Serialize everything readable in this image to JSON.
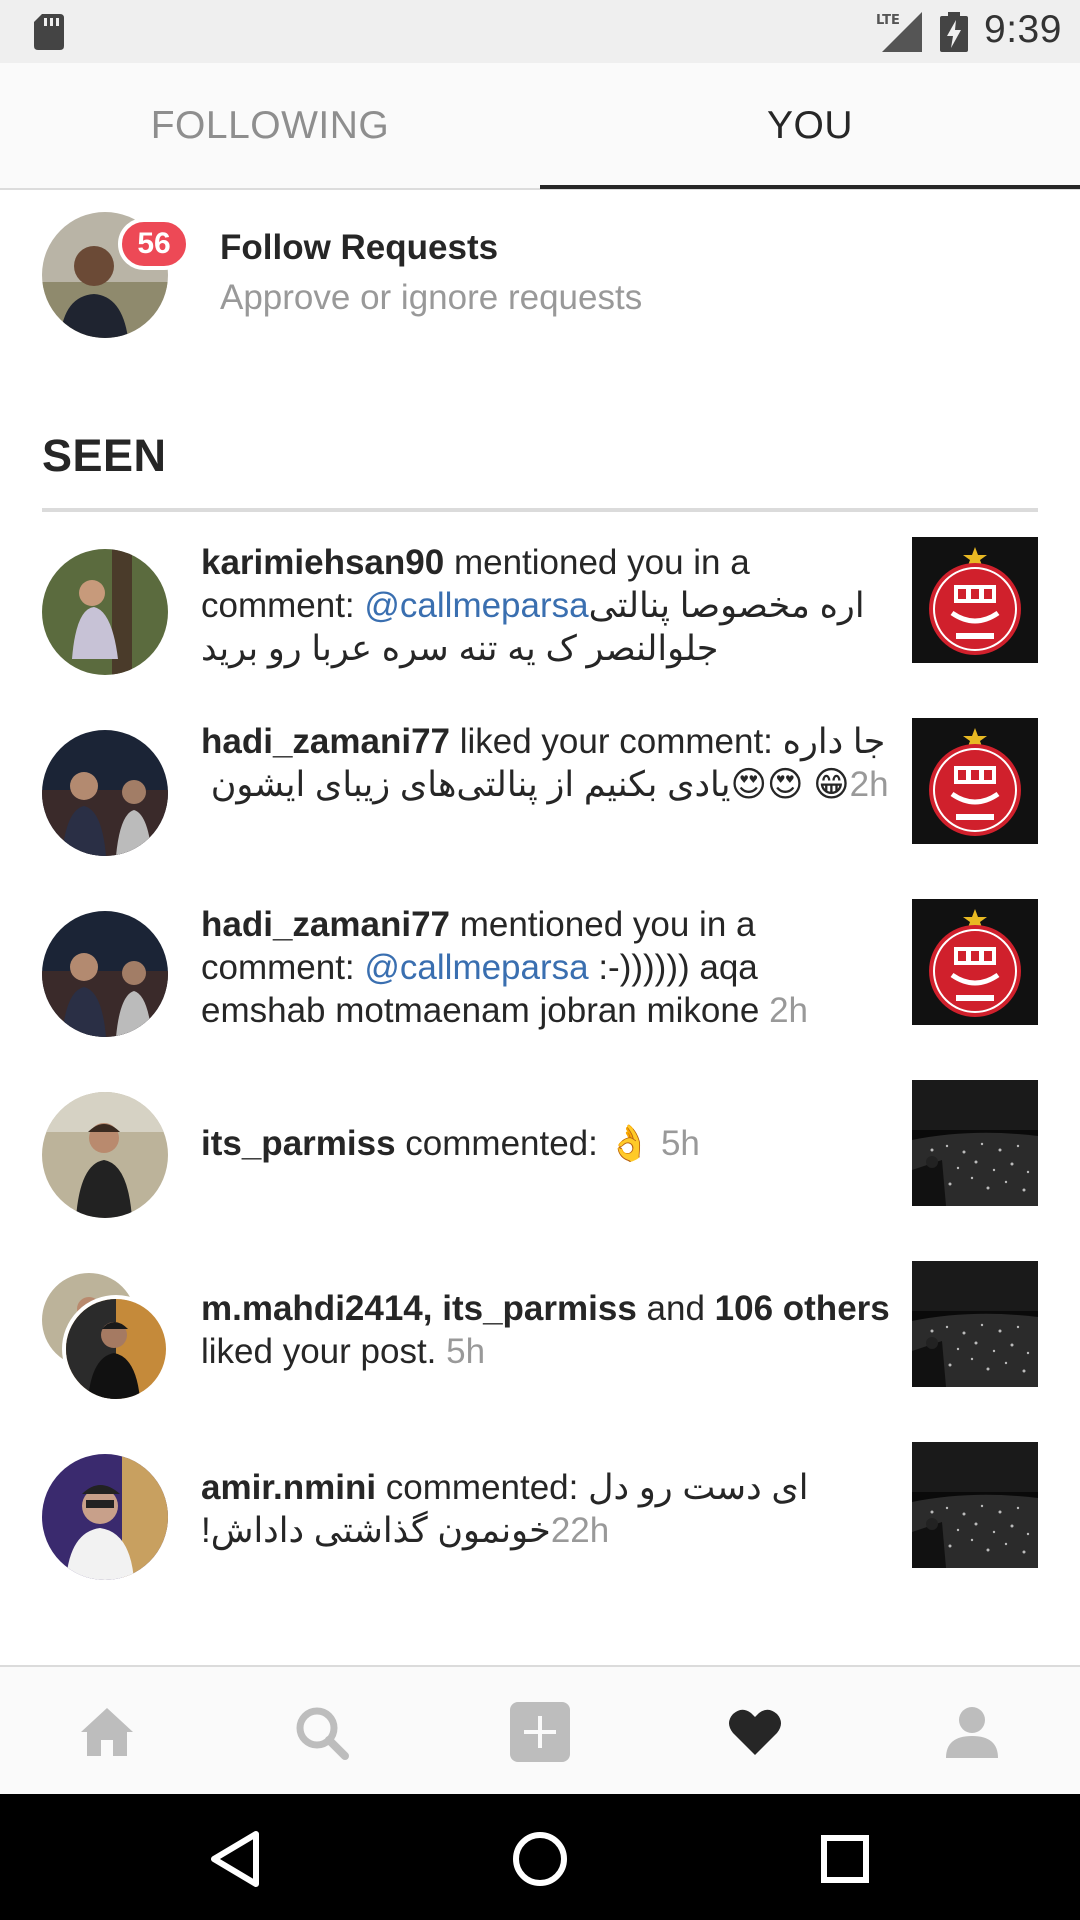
{
  "status_bar": {
    "time": "9:39",
    "network": "LTE"
  },
  "tabs": [
    {
      "label": "FOLLOWING",
      "active": false
    },
    {
      "label": "YOU",
      "active": true
    }
  ],
  "follow_requests": {
    "badge_count": "56",
    "title": "Follow Requests",
    "subtitle": "Approve or ignore requests"
  },
  "section": {
    "title": "SEEN"
  },
  "activities": [
    {
      "user": "karimiehsan90",
      "action": " mentioned you in a comment: ",
      "mention": "@callmeparsa",
      "text": " اره مخصوصا پنالتی جلوالنصر ک یه تنه سره عربا رو برید",
      "time": "",
      "thumb": "persepolis-logo"
    },
    {
      "user": "hadi_zamani77",
      "action": " liked your comment: ",
      "text_before": "جا داره یادی بکنیم از پنالتی‌های زیبای ایشون ",
      "emoji": "😍😍",
      "text_after": " 😁",
      "time": "2h",
      "thumb": "persepolis-logo"
    },
    {
      "user": "hadi_zamani77",
      "action": " mentioned you in a comment: ",
      "mention": "@callmeparsa",
      "text": " :-)))))) aqa emshab motmaenam jobran mikone",
      "time": "2h",
      "thumb": "persepolis-logo"
    },
    {
      "user": "its_parmiss",
      "action": " commented: ",
      "emoji": "👌",
      "time": "5h",
      "thumb": "night-city-photo"
    },
    {
      "user": "m.mahdi2414",
      "sep": ", ",
      "user2": "its_parmiss",
      "and": " and ",
      "others": "106 others",
      "action": " liked your post.",
      "time": "5h",
      "thumb": "night-city-photo"
    },
    {
      "user": "amir.nmini",
      "action": " commented: ",
      "text": "ای دست رو دل خونمون گذاشتی داداش!",
      "time": "22h",
      "thumb": "night-city-photo"
    }
  ],
  "bottom_nav": [
    {
      "icon": "home-icon"
    },
    {
      "icon": "search-icon"
    },
    {
      "icon": "add-post-icon"
    },
    {
      "icon": "heart-icon",
      "active": true
    },
    {
      "icon": "profile-icon"
    }
  ],
  "colors": {
    "badge": "#ed4956",
    "mention": "#3a6fb0",
    "muted": "#999999",
    "text": "#262626"
  }
}
